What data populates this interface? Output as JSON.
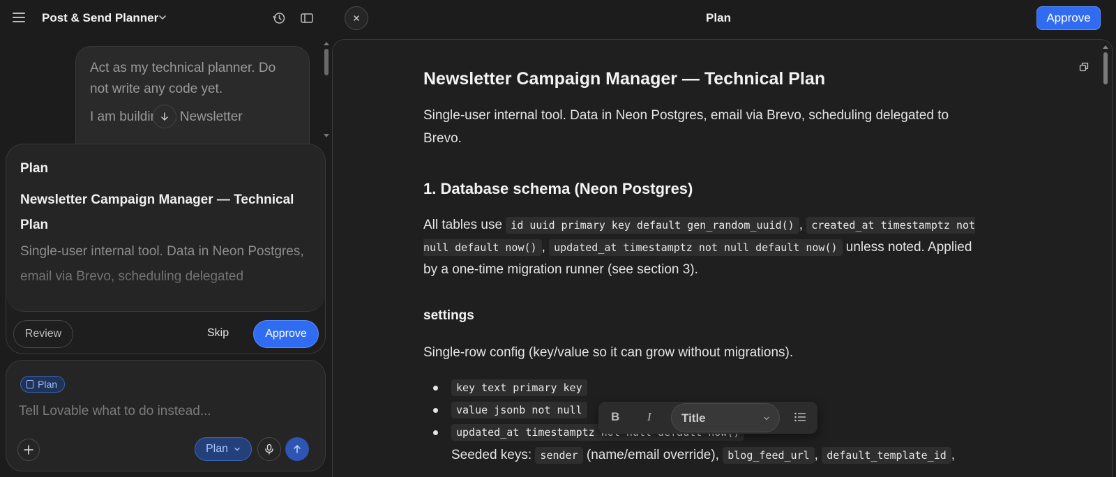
{
  "header": {
    "project_name": "Post & Send Planner",
    "panel_title": "Plan",
    "approve_label": "Approve"
  },
  "chat": {
    "user_message": [
      "Act as my technical planner. Do not write any code yet.",
      "I am building a Newsletter"
    ]
  },
  "plan_card": {
    "label": "Plan",
    "title": "Newsletter Campaign Manager — Technical Plan",
    "description": "Single-user internal tool. Data in Neon Postgres, email via Brevo, scheduling delegated",
    "review_label": "Review",
    "skip_label": "Skip",
    "approve_label": "Approve"
  },
  "composer": {
    "chip_label": "Plan",
    "placeholder": "Tell Lovable what to do instead...",
    "mode_label": "Plan"
  },
  "document": {
    "title": "Newsletter Campaign Manager — Technical Plan",
    "intro": "Single-user internal tool. Data in Neon Postgres, email via Brevo, scheduling delegated to Brevo.",
    "section1_heading": "1. Database schema (Neon Postgres)",
    "section1_para": {
      "t1": "All tables use",
      "c1": "id uuid primary key default gen_random_uuid()",
      "t2": ",",
      "c2": "created_at timestamptz not null default now()",
      "t3": ",",
      "c3": "updated_at timestamptz not null default now()",
      "t4": "unless noted. Applied by a one-time migration runner (see section 3)."
    },
    "settings_heading": "settings",
    "settings_desc": "Single-row config (key/value so it can grow without migrations).",
    "settings_fields": [
      "key text primary key",
      "value jsonb not null",
      "updated_at timestamptz not null default now()"
    ],
    "seeded": {
      "label": "Seeded keys:",
      "c1": "sender",
      "t1": "(name/email override),",
      "c2": "blog_feed_url",
      "t2": ",",
      "c3": "default_template_id",
      "t3": ","
    }
  },
  "format_toolbar": {
    "bold": "B",
    "italic": "I",
    "style_label": "Title"
  },
  "colors": {
    "accent": "#2f6cf2",
    "background": "#1c1c1c",
    "panel": "#1f1f1f"
  }
}
